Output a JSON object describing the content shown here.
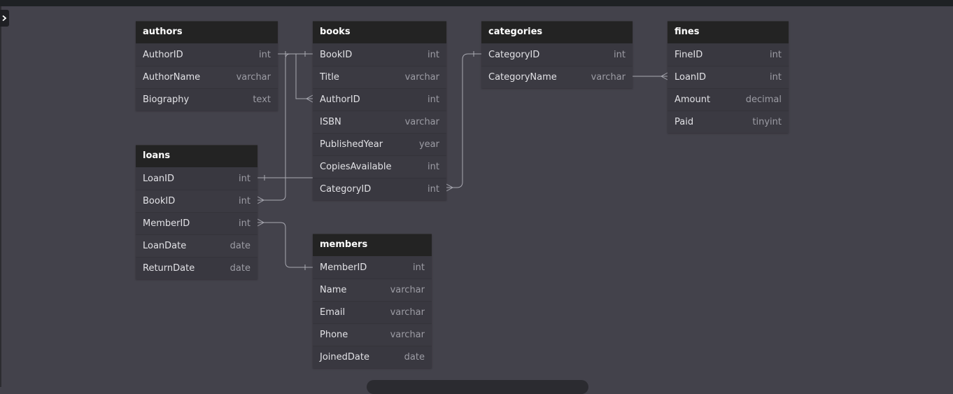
{
  "tables": {
    "authors": {
      "name": "authors",
      "columns": [
        {
          "name": "AuthorID",
          "type": "int"
        },
        {
          "name": "AuthorName",
          "type": "varchar"
        },
        {
          "name": "Biography",
          "type": "text"
        }
      ]
    },
    "books": {
      "name": "books",
      "columns": [
        {
          "name": "BookID",
          "type": "int"
        },
        {
          "name": "Title",
          "type": "varchar"
        },
        {
          "name": "AuthorID",
          "type": "int"
        },
        {
          "name": "ISBN",
          "type": "varchar"
        },
        {
          "name": "PublishedYear",
          "type": "year"
        },
        {
          "name": "CopiesAvailable",
          "type": "int"
        },
        {
          "name": "CategoryID",
          "type": "int"
        }
      ]
    },
    "categories": {
      "name": "categories",
      "columns": [
        {
          "name": "CategoryID",
          "type": "int"
        },
        {
          "name": "CategoryName",
          "type": "varchar"
        }
      ]
    },
    "fines": {
      "name": "fines",
      "columns": [
        {
          "name": "FineID",
          "type": "int"
        },
        {
          "name": "LoanID",
          "type": "int"
        },
        {
          "name": "Amount",
          "type": "decimal"
        },
        {
          "name": "Paid",
          "type": "tinyint"
        }
      ]
    },
    "loans": {
      "name": "loans",
      "columns": [
        {
          "name": "LoanID",
          "type": "int"
        },
        {
          "name": "BookID",
          "type": "int"
        },
        {
          "name": "MemberID",
          "type": "int"
        },
        {
          "name": "LoanDate",
          "type": "date"
        },
        {
          "name": "ReturnDate",
          "type": "date"
        }
      ]
    },
    "members": {
      "name": "members",
      "columns": [
        {
          "name": "MemberID",
          "type": "int"
        },
        {
          "name": "Name",
          "type": "varchar"
        },
        {
          "name": "Email",
          "type": "varchar"
        },
        {
          "name": "Phone",
          "type": "varchar"
        },
        {
          "name": "JoinedDate",
          "type": "date"
        }
      ]
    }
  },
  "colors": {
    "canvas": "#43424b",
    "header": "#232323",
    "row": "#3a3940",
    "connector": "#a9a9b2"
  }
}
